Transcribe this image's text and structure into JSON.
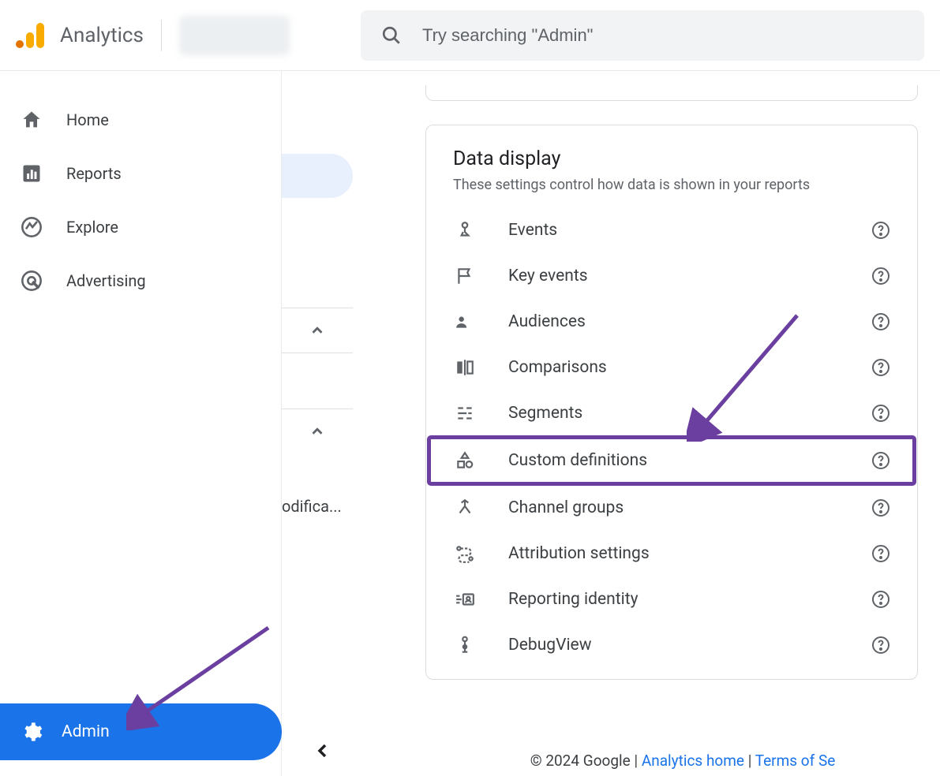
{
  "brand": "Analytics",
  "search": {
    "placeholder": "Try searching \"Admin\""
  },
  "sidebar": {
    "items": [
      {
        "label": "Home"
      },
      {
        "label": "Reports"
      },
      {
        "label": "Explore"
      },
      {
        "label": "Advertising"
      }
    ],
    "admin_label": "Admin"
  },
  "middle": {
    "truncated": "odifica..."
  },
  "card": {
    "title": "Data display",
    "subtitle": "These settings control how data is shown in your reports",
    "rows": [
      {
        "label": "Events",
        "icon": "touch"
      },
      {
        "label": "Key events",
        "icon": "flag"
      },
      {
        "label": "Audiences",
        "icon": "people"
      },
      {
        "label": "Comparisons",
        "icon": "compare"
      },
      {
        "label": "Segments",
        "icon": "segment"
      },
      {
        "label": "Custom definitions",
        "icon": "shapes",
        "highlight": true
      },
      {
        "label": "Channel groups",
        "icon": "merge"
      },
      {
        "label": "Attribution settings",
        "icon": "path"
      },
      {
        "label": "Reporting identity",
        "icon": "identity"
      },
      {
        "label": "DebugView",
        "icon": "debug"
      }
    ]
  },
  "footer": {
    "copyright": "© 2024 Google",
    "links": [
      "Analytics home",
      "Terms of Se"
    ]
  }
}
